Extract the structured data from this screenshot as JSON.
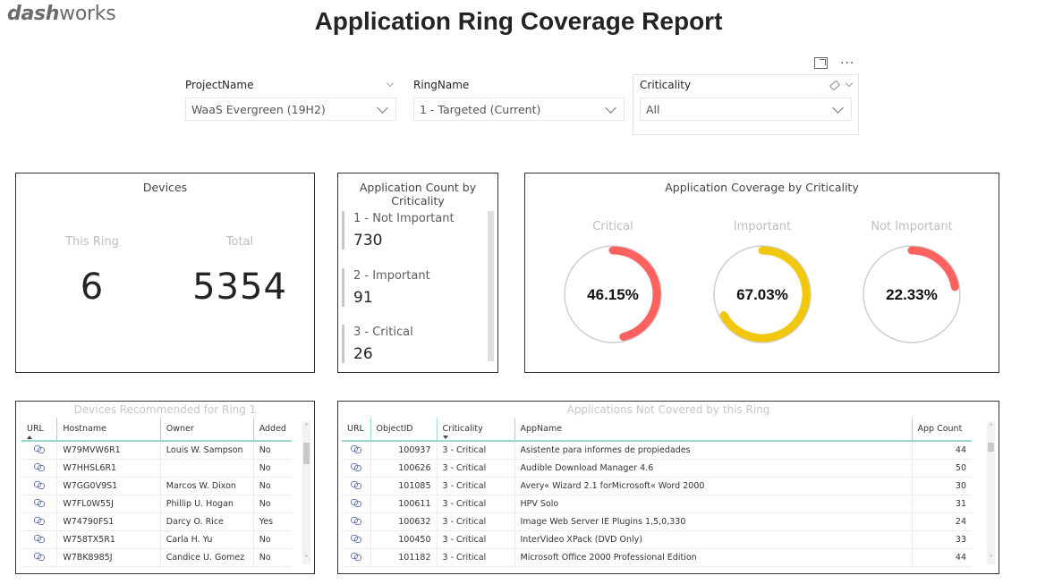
{
  "brand": {
    "logo_bold": "dash",
    "logo_light": "works"
  },
  "page": {
    "title": "Application Ring Coverage Report"
  },
  "visual_header": {
    "focus_icon": "focus-mode-icon",
    "more_icon": "more-options-icon",
    "more_label": "···"
  },
  "slicers": {
    "project": {
      "label": "ProjectName",
      "value": "WaaS Evergreen (19H2)"
    },
    "ring": {
      "label": "RingName",
      "value": "1 - Targeted (Current)"
    },
    "criticality": {
      "label": "Criticality",
      "value": "All"
    }
  },
  "devices_card": {
    "title": "Devices",
    "this_ring_label": "This Ring",
    "this_ring_value": "6",
    "total_label": "Total",
    "total_value": "5354"
  },
  "app_count_card": {
    "title": "Application Count by Criticality",
    "rows": [
      {
        "label": "1 - Not Important",
        "value": "730"
      },
      {
        "label": "2 - Important",
        "value": "91"
      },
      {
        "label": "3 - Critical",
        "value": "26"
      }
    ]
  },
  "coverage_card": {
    "title": "Application Coverage by Criticality",
    "gauges": [
      {
        "label": "Critical",
        "value_text": "46.15%",
        "percent": 46.15,
        "color": "#fd625e"
      },
      {
        "label": "Important",
        "value_text": "67.03%",
        "percent": 67.03,
        "color": "#f2c80f"
      },
      {
        "label": "Not Important",
        "value_text": "22.33%",
        "percent": 22.33,
        "color": "#fd625e"
      }
    ]
  },
  "devices_table": {
    "title": "Devices Recommended for Ring 1",
    "columns": [
      "URL",
      "Hostname",
      "Owner",
      "Added"
    ],
    "rows": [
      {
        "hostname": "W79MVW6R1",
        "owner": "Louis W. Sampson",
        "added": "No"
      },
      {
        "hostname": "W7HHSL6R1",
        "owner": "",
        "added": "No"
      },
      {
        "hostname": "W7GG0V9S1",
        "owner": "Marcos W. Dixon",
        "added": "No"
      },
      {
        "hostname": "W7FL0W55J",
        "owner": "Phillip U. Hogan",
        "added": "No"
      },
      {
        "hostname": "W74790FS1",
        "owner": "Darcy O. Rice",
        "added": "Yes"
      },
      {
        "hostname": "W758TX5R1",
        "owner": "Carla H. Yu",
        "added": "No"
      },
      {
        "hostname": "W7BK8985J",
        "owner": "Candice U. Gomez",
        "added": "No"
      }
    ]
  },
  "apps_table": {
    "title": "Applications Not Covered by this Ring",
    "columns": [
      "URL",
      "ObjectID",
      "Criticality",
      "AppName",
      "App Count"
    ],
    "rows": [
      {
        "object_id": "100937",
        "criticality": "3 - Critical",
        "app_name": "Asistente para informes de propiedades",
        "app_count": "44"
      },
      {
        "object_id": "100626",
        "criticality": "3 - Critical",
        "app_name": "Audible Download Manager 4.6",
        "app_count": "50"
      },
      {
        "object_id": "101085",
        "criticality": "3 - Critical",
        "app_name": "Avery« Wizard 2.1 forMicrosoft« Word 2000",
        "app_count": "30"
      },
      {
        "object_id": "100611",
        "criticality": "3 - Critical",
        "app_name": "HPV Solo",
        "app_count": "31"
      },
      {
        "object_id": "100632",
        "criticality": "3 - Critical",
        "app_name": "Image Web Server IE Plugins 1,5,0,330",
        "app_count": "24"
      },
      {
        "object_id": "100450",
        "criticality": "3 - Critical",
        "app_name": "InterVideo XPack (DVD Only)",
        "app_count": "33"
      },
      {
        "object_id": "101182",
        "criticality": "3 - Critical",
        "app_name": "Microsoft Office 2000 Professional Edition",
        "app_count": "44"
      }
    ]
  }
}
